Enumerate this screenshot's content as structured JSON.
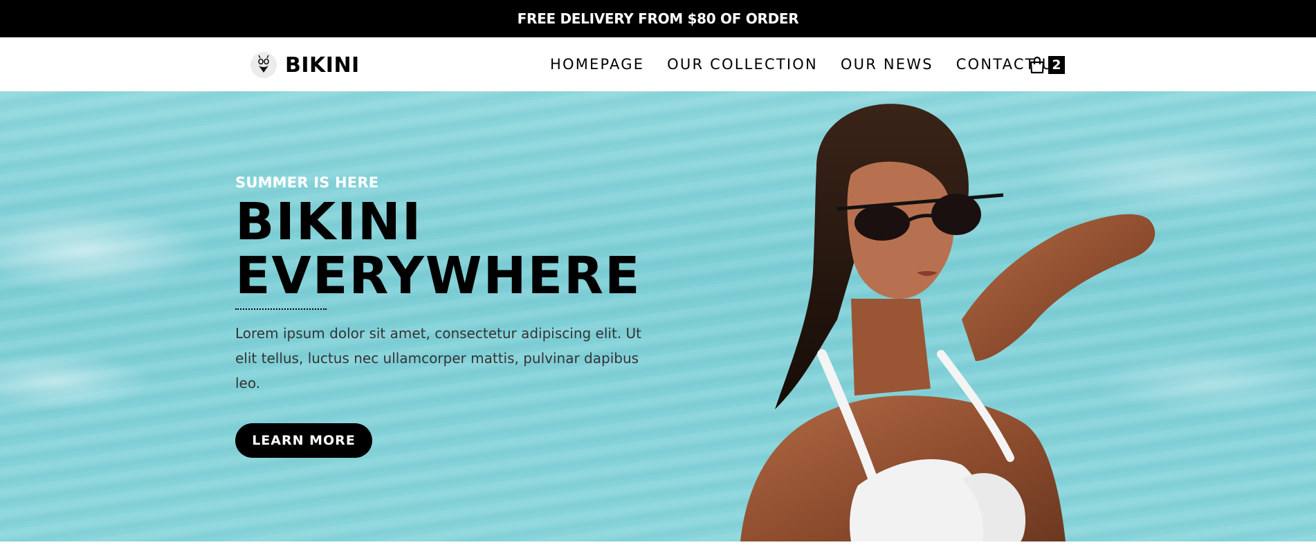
{
  "announcement": {
    "text": "FREE DELIVERY FROM $80 OF ORDER"
  },
  "header": {
    "brand_name": "BIKINI",
    "nav": [
      {
        "label": "HOMEPAGE"
      },
      {
        "label": "OUR COLLECTION"
      },
      {
        "label": "OUR NEWS"
      },
      {
        "label": "CONTACT US"
      }
    ],
    "cart": {
      "icon": "shopping-bag-icon",
      "count": "2"
    }
  },
  "hero": {
    "eyebrow": "SUMMER IS HERE",
    "headline_line1": "BIKINI",
    "headline_line2": "EVERYWHERE",
    "description": "Lorem ipsum dolor sit amet, consectetur adipiscing elit. Ut elit tellus, luctus nec ullamcorper mattis, pulvinar dapibus leo.",
    "cta_label": "LEARN MORE",
    "image": "model-in-pool-with-sunglasses"
  },
  "colors": {
    "topbar_bg": "#000000",
    "water": "#84d3d9",
    "accent": "#000000",
    "text": "#333333"
  }
}
